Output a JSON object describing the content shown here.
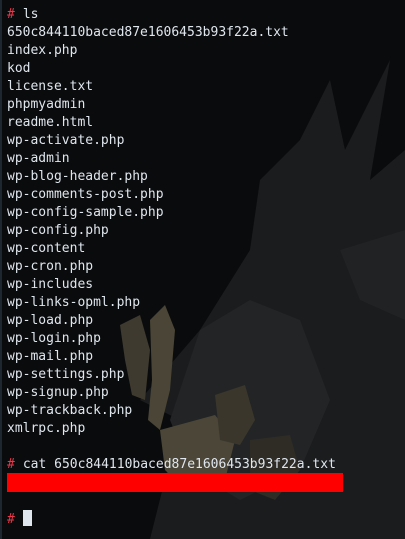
{
  "prompt_symbol": "#",
  "commands": {
    "ls": "ls",
    "cat": "cat 650c844110baced87e1606453b93f22a.txt"
  },
  "files": [
    "650c844110baced87e1606453b93f22a.txt",
    "index.php",
    "kod",
    "license.txt",
    "phpmyadmin",
    "readme.html",
    "wp-activate.php",
    "wp-admin",
    "wp-blog-header.php",
    "wp-comments-post.php",
    "wp-config-sample.php",
    "wp-config.php",
    "wp-content",
    "wp-cron.php",
    "wp-includes",
    "wp-links-opml.php",
    "wp-load.php",
    "wp-login.php",
    "wp-mail.php",
    "wp-settings.php",
    "wp-signup.php",
    "wp-trackback.php",
    "xmlrpc.php"
  ],
  "colors": {
    "background": "#0a0b0c",
    "text": "#dfe6ee",
    "prompt": "#e8364a",
    "redaction": "#ff0000"
  }
}
